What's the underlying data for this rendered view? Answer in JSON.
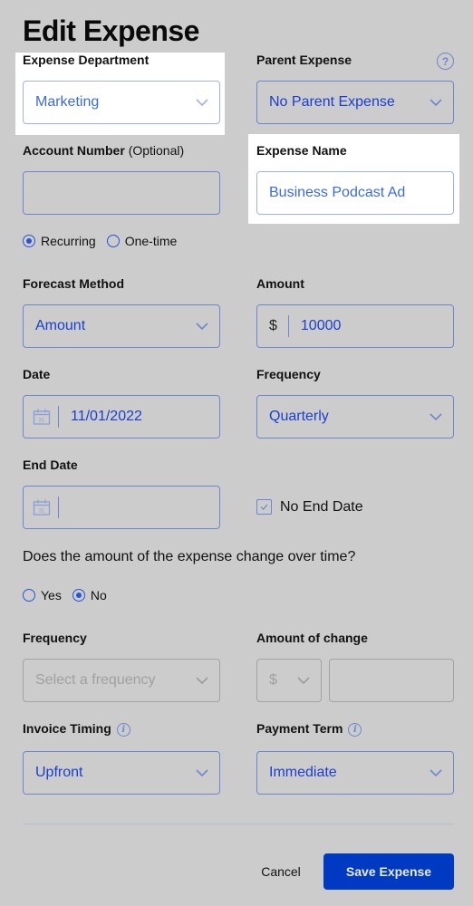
{
  "page": {
    "title": "Edit Expense"
  },
  "colors": {
    "accent": "#0039c2",
    "field_text": "#1a3fcf",
    "border": "#6e86cf",
    "overlay_bg": "#cccccc"
  },
  "form": {
    "expense_department": {
      "label": "Expense Department",
      "value": "Marketing"
    },
    "parent_expense": {
      "label": "Parent Expense",
      "value": "No Parent Expense",
      "help_icon": "?"
    },
    "account_number": {
      "label": "Account Number",
      "optional": "(Optional)",
      "value": ""
    },
    "expense_name": {
      "label": "Expense Name",
      "value": "Business Podcast Ad"
    },
    "type_options": [
      {
        "label": "Recurring",
        "selected": true
      },
      {
        "label": "One-time",
        "selected": false
      }
    ],
    "forecast_method": {
      "label": "Forecast Method",
      "value": "Amount"
    },
    "amount": {
      "label": "Amount",
      "prefix": "$",
      "value": "10000"
    },
    "date": {
      "label": "Date",
      "value": "11/01/2022",
      "calendar_day": "31"
    },
    "frequency": {
      "label": "Frequency",
      "value": "Quarterly"
    },
    "end_date": {
      "label": "End Date",
      "value": "",
      "calendar_day": "31"
    },
    "no_end_date": {
      "label": "No End Date",
      "checked": true
    },
    "change_question": "Does the amount of the expense change over time?",
    "change_options": [
      {
        "label": "Yes",
        "selected": false
      },
      {
        "label": "No",
        "selected": true
      }
    ],
    "change_frequency": {
      "label": "Frequency",
      "placeholder": "Select a frequency"
    },
    "amount_of_change": {
      "label": "Amount of change",
      "unit": "$",
      "value": ""
    },
    "invoice_timing": {
      "label": "Invoice Timing",
      "value": "Upfront",
      "info_icon": "i"
    },
    "payment_term": {
      "label": "Payment Term",
      "value": "Immediate",
      "info_icon": "i"
    }
  },
  "actions": {
    "cancel_label": "Cancel",
    "save_label": "Save Expense"
  }
}
